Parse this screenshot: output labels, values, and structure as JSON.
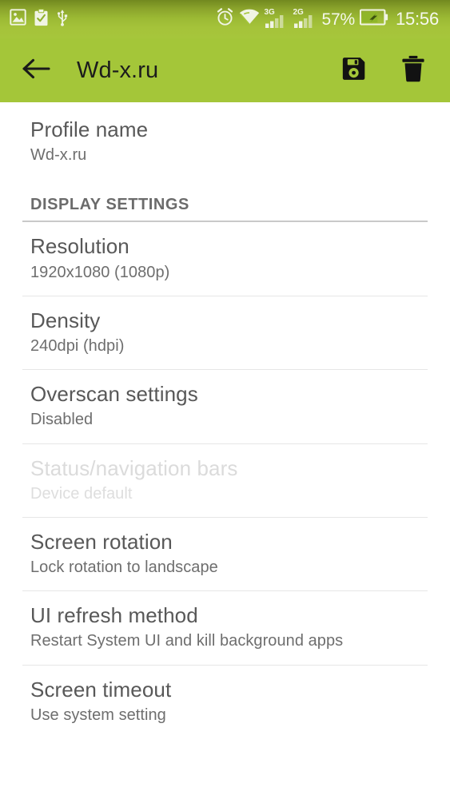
{
  "status_bar": {
    "left_icons": [
      {
        "name": "image-icon",
        "label": "Image"
      },
      {
        "name": "clipboard-check-icon",
        "label": "Clipboard"
      },
      {
        "name": "usb-icon",
        "label": "USB"
      }
    ],
    "right_icons": [
      {
        "name": "alarm-clock-icon",
        "label": "Alarm"
      },
      {
        "name": "wifi-icon",
        "label": "Wi-Fi"
      }
    ],
    "signal_1_label": "3G",
    "signal_2_label": "2G",
    "battery_percent": "57%",
    "battery_icon": "battery-charging-icon",
    "clock": "15:56",
    "background_color": "#a4c639"
  },
  "action_bar": {
    "back_icon": "arrow-left-icon",
    "title": "Wd-x.ru",
    "save_icon": "floppy-disk-save-icon",
    "save_label": "Save",
    "delete_icon": "trash-delete-icon",
    "delete_label": "Delete",
    "background_color": "#a4c639",
    "title_color": "#1c1c1c"
  },
  "content": {
    "profile": {
      "title": "Profile name",
      "summary": "Wd-x.ru"
    },
    "section_header": "DISPLAY SETTINGS",
    "preferences": [
      {
        "title": "Resolution",
        "summary": "1920x1080 (1080p)",
        "disabled": false
      },
      {
        "title": "Density",
        "summary": "240dpi (hdpi)",
        "disabled": false
      },
      {
        "title": "Overscan settings",
        "summary": "Disabled",
        "disabled": false
      },
      {
        "title": "Status/navigation bars",
        "summary": "Device default",
        "disabled": true
      },
      {
        "title": "Screen rotation",
        "summary": "Lock rotation to landscape",
        "disabled": false
      },
      {
        "title": "UI refresh method",
        "summary": "Restart System UI and kill background apps",
        "disabled": false
      },
      {
        "title": "Screen timeout",
        "summary": "Use system setting",
        "disabled": false
      }
    ]
  },
  "colors": {
    "accent_green": "#a4c639",
    "status_bar_dark": "#72891f",
    "title_text": "#585858",
    "summary_text": "#6e6e6e",
    "disabled_text": "#dbdbdb",
    "divider": "#e6e6e6",
    "background": "#ffffff"
  }
}
